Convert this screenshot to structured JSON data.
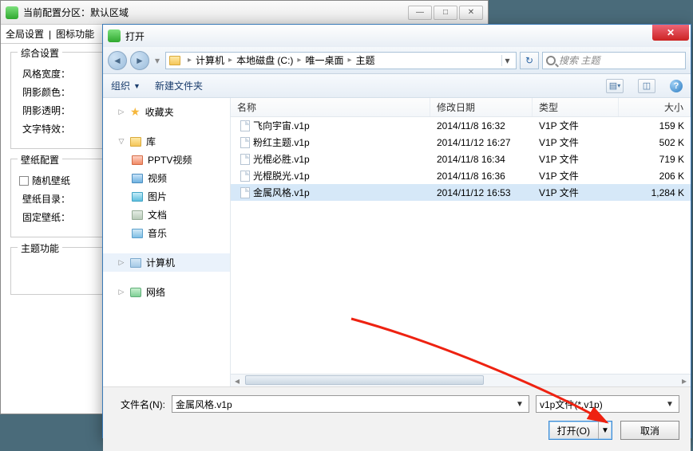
{
  "bg": {
    "title": "当前配置分区：默认区域",
    "tabs": [
      "全局设置",
      "图标功能"
    ],
    "group1": {
      "legend": "综合设置",
      "r1": "风格宽度：",
      "r2": "阴影颜色：",
      "r3": "阴影透明：",
      "r4": "文字特效："
    },
    "group2": {
      "legend": "壁纸配置",
      "chk": "随机壁纸",
      "r2": "壁纸目录：",
      "r3": "固定壁纸："
    },
    "group3": {
      "legend": "主题功能"
    }
  },
  "dlg": {
    "title": "打开",
    "breadcrumb": [
      "计算机",
      "本地磁盘 (C:)",
      "唯一桌面",
      "主题"
    ],
    "search_placeholder": "搜索 主题",
    "toolbar": {
      "organize": "组织",
      "newfolder": "新建文件夹"
    },
    "sidebar": {
      "favorites": "收藏夹",
      "libraries": "库",
      "lib_items": [
        "PPTV视频",
        "视频",
        "图片",
        "文档",
        "音乐"
      ],
      "computer": "计算机",
      "network": "网络"
    },
    "columns": {
      "name": "名称",
      "date": "修改日期",
      "type": "类型",
      "size": "大小"
    },
    "files": [
      {
        "name": "飞向宇宙.v1p",
        "date": "2014/11/8 16:32",
        "type": "V1P 文件",
        "size": "159 K"
      },
      {
        "name": "粉红主题.v1p",
        "date": "2014/11/12 16:27",
        "type": "V1P 文件",
        "size": "502 K"
      },
      {
        "name": "光棍必胜.v1p",
        "date": "2014/11/8 16:34",
        "type": "V1P 文件",
        "size": "719 K"
      },
      {
        "name": "光棍脱光.v1p",
        "date": "2014/11/8 16:36",
        "type": "V1P 文件",
        "size": "206 K"
      },
      {
        "name": "金属风格.v1p",
        "date": "2014/11/12 16:53",
        "type": "V1P 文件",
        "size": "1,284 K"
      }
    ],
    "selected_index": 4,
    "filename_label": "文件名(N):",
    "filename_value": "金属风格.v1p",
    "filter": "v1p文件(*.v1p)",
    "open_btn": "打开(O)",
    "cancel_btn": "取消"
  }
}
